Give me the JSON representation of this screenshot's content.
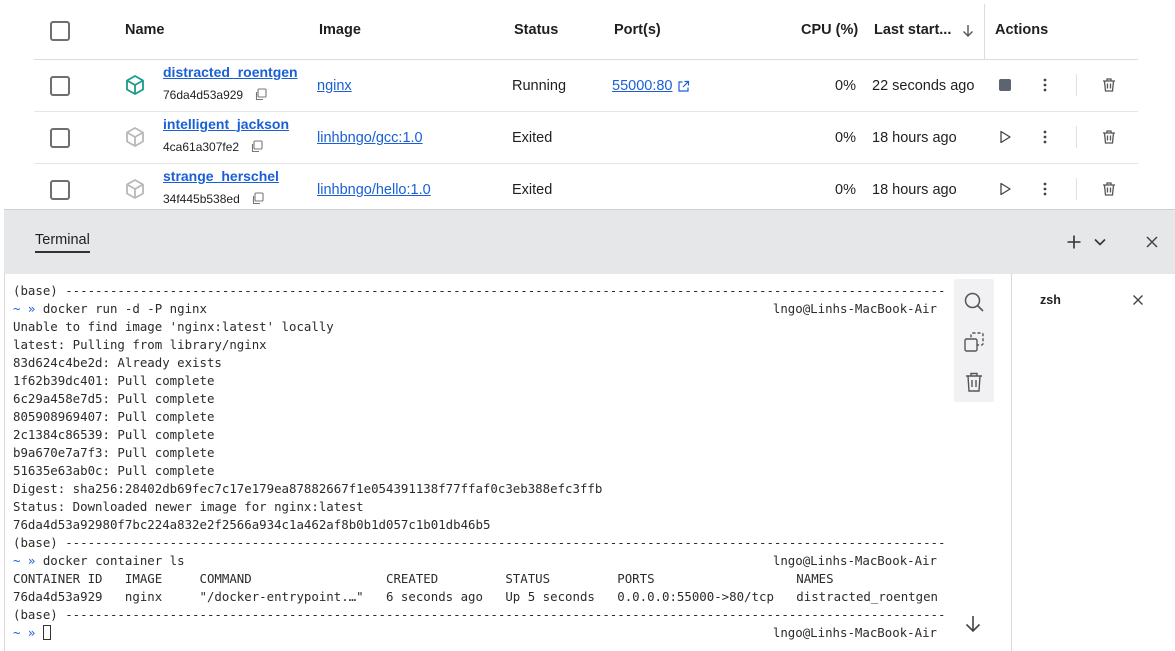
{
  "table": {
    "headers": {
      "name": "Name",
      "image": "Image",
      "status": "Status",
      "ports": "Port(s)",
      "cpu": "CPU (%)",
      "last_started": "Last start...",
      "actions": "Actions"
    },
    "rows": [
      {
        "name": "distracted_roentgen",
        "id": "76da4d53a929",
        "image": "nginx",
        "status": "Running",
        "ports": "55000:80",
        "cpu": "0%",
        "last_started": "22 seconds ago",
        "running": true
      },
      {
        "name": "intelligent_jackson",
        "id": "4ca61a307fe2",
        "image": "linhbngo/gcc:1.0",
        "status": "Exited",
        "ports": "",
        "cpu": "0%",
        "last_started": "18 hours ago",
        "running": false
      },
      {
        "name": "strange_herschel",
        "id": "34f445b538ed",
        "image": "linhbngo/hello:1.0",
        "status": "Exited",
        "ports": "",
        "cpu": "0%",
        "last_started": "18 hours ago",
        "running": false
      }
    ]
  },
  "terminal": {
    "tab_label": "Terminal",
    "session_name": "zsh",
    "lines": [
      {
        "text": "(base) --------------------------------------------------------------------------------------------------------------------------------------",
        "host": ""
      },
      {
        "text": "~ » docker run -d -P nginx",
        "host": "lngo@Linhs-MacBook-Air",
        "prompt": true
      },
      {
        "text": "Unable to find image 'nginx:latest' locally",
        "host": ""
      },
      {
        "text": "latest: Pulling from library/nginx",
        "host": ""
      },
      {
        "text": "83d624c4be2d: Already exists",
        "host": ""
      },
      {
        "text": "1f62b39dc401: Pull complete",
        "host": ""
      },
      {
        "text": "6c29a458e7d5: Pull complete",
        "host": ""
      },
      {
        "text": "805908969407: Pull complete",
        "host": ""
      },
      {
        "text": "2c1384c86539: Pull complete",
        "host": ""
      },
      {
        "text": "b9a670e7a7f3: Pull complete",
        "host": ""
      },
      {
        "text": "51635e63ab0c: Pull complete",
        "host": ""
      },
      {
        "text": "Digest: sha256:28402db69fec7c17e179ea87882667f1e054391138f77ffaf0c3eb388efc3ffb",
        "host": ""
      },
      {
        "text": "Status: Downloaded newer image for nginx:latest",
        "host": ""
      },
      {
        "text": "76da4d53a92980f7bc224a832e2f2566a934c1a462af8b0b1d057c1b01db46b5",
        "host": ""
      },
      {
        "text": "(base) --------------------------------------------------------------------------------------------------------------------------------------",
        "host": ""
      },
      {
        "text": "~ » docker container ls",
        "host": "lngo@Linhs-MacBook-Air",
        "prompt": true
      },
      {
        "text": "CONTAINER ID   IMAGE     COMMAND                  CREATED         STATUS         PORTS                   NAMES",
        "host": ""
      },
      {
        "text": "76da4d53a929   nginx     \"/docker-entrypoint.…\"   6 seconds ago   Up 5 seconds   0.0.0.0:55000->80/tcp   distracted_roentgen",
        "host": ""
      },
      {
        "text": "(base) --------------------------------------------------------------------------------------------------------------------------------------",
        "host": ""
      },
      {
        "text": "~ » ",
        "host": "lngo@Linhs-MacBook-Air",
        "prompt": true,
        "cursor": true
      }
    ]
  },
  "colors": {
    "link": "#1a5fd6",
    "running_icon": "#1a9a8a",
    "exited_icon": "#b8b8b8",
    "terminal_header_bg": "#e6e7e9"
  },
  "icons": {
    "sort": "arrow-down-icon",
    "container_running": "cube-icon",
    "copy": "copy-icon",
    "external": "external-link-icon",
    "stop": "stop-icon",
    "start": "play-icon",
    "more": "kebab-icon",
    "delete": "trash-icon"
  }
}
